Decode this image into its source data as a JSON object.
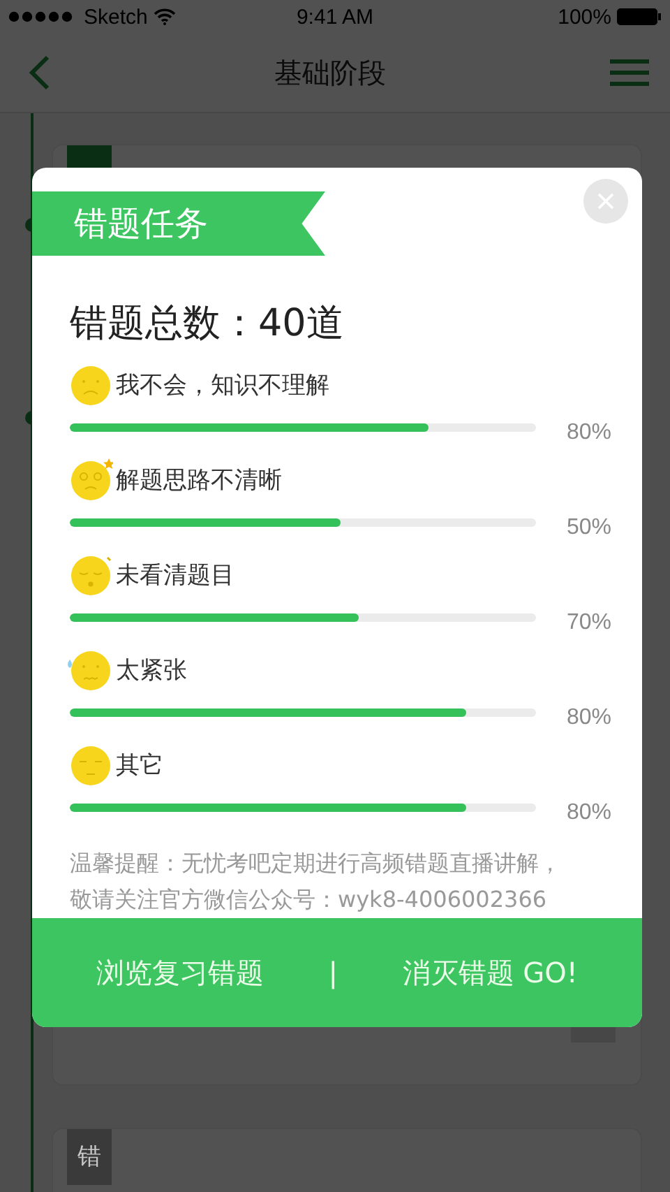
{
  "status_bar": {
    "carrier": "Sketch",
    "time": "9:41 AM",
    "battery": "100%"
  },
  "nav": {
    "title": "基础阶段"
  },
  "cards": [
    {
      "kind": "large"
    },
    {
      "kind": "small",
      "badge": "错"
    }
  ],
  "dialog": {
    "ribbon": "错题任务",
    "total": "错题总数：40道",
    "reasons": [
      {
        "kind": "confused",
        "label": "我不会，知识不理解",
        "level": 0.77,
        "reading": "80%"
      },
      {
        "kind": "dizzy",
        "label": "解题思路不清晰",
        "level": 0.58,
        "reading": "50%"
      },
      {
        "kind": "sleepy",
        "label": "未看清题目",
        "level": 0.62,
        "reading": "70%"
      },
      {
        "kind": "nervous",
        "label": "太紧张",
        "level": 0.85,
        "reading": "80%"
      },
      {
        "kind": "calm",
        "label": "其它",
        "level": 0.85,
        "reading": "80%"
      }
    ],
    "tip": "温馨提醒：无忧考吧定期进行高频错题直播讲解，敬请关注官方微信公众号：wyk8-4006002366",
    "buttons": [
      "浏览复习错题",
      "消灭错题 GO!"
    ],
    "separator": "|"
  }
}
